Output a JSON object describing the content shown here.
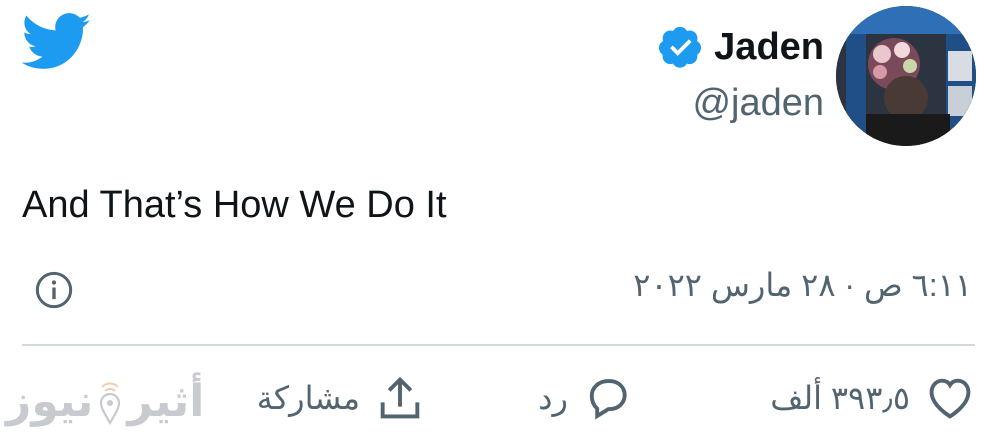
{
  "user": {
    "display_name": "Jaden",
    "handle": "@jaden",
    "verified": true
  },
  "tweet": {
    "text": "And That’s How We Do It",
    "timestamp": "٦:١١ ص · ٢٨ مارس ٢٠٢٢"
  },
  "actions": {
    "like_count": "٣٩٣٫٥ ألف",
    "reply_label": "رد",
    "share_label": "مشاركة"
  },
  "watermark": {
    "part1": "أثير",
    "part2": "نيوز"
  },
  "colors": {
    "twitter_blue": "#1d9bf0",
    "secondary_text": "#536471",
    "divider": "#cfd9de"
  },
  "icons": [
    "twitter-bird-icon",
    "verified-badge-icon",
    "info-icon",
    "heart-icon",
    "reply-bubble-icon",
    "share-upload-icon",
    "location-pin-icon"
  ]
}
